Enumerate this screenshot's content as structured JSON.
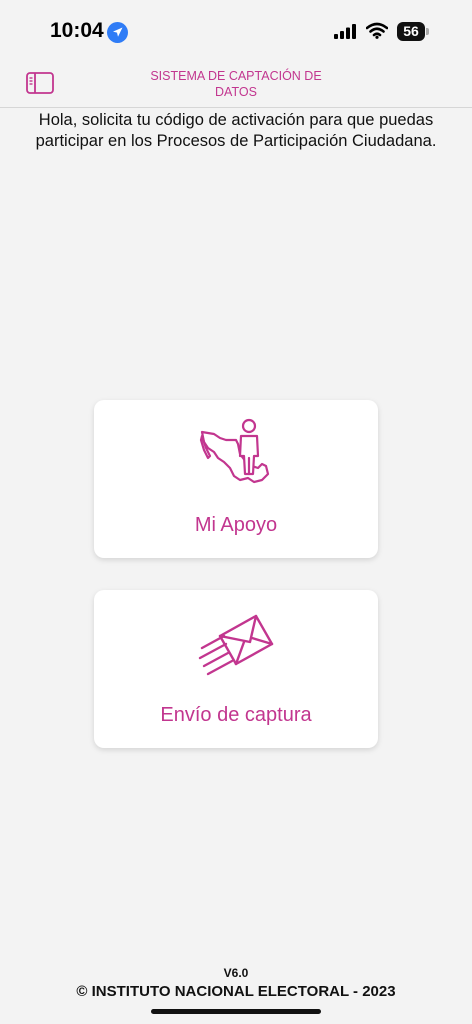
{
  "status_bar": {
    "time": "10:04",
    "battery": "56",
    "icons": [
      "location-arrow-icon",
      "signal-icon",
      "wifi-icon",
      "battery-icon"
    ]
  },
  "header": {
    "title": "SISTEMA DE CAPTACIÓN DE DATOS",
    "menu_icon": "sidebar-toggle-icon"
  },
  "intro_text": "Hola, solicita tu código de activación para que puedas participar en los Procesos de Participación Ciudadana.",
  "cards": [
    {
      "label": "Mi Apoyo",
      "icon": "person-map-icon"
    },
    {
      "label": "Envío de captura",
      "icon": "envelope-send-icon"
    }
  ],
  "footer": {
    "version": "V6.0",
    "copyright": "© INSTITUTO NACIONAL ELECTORAL - 2023"
  },
  "colors": {
    "accent": "#c2368f",
    "background": "#f3f3f3",
    "card": "#ffffff",
    "location": "#2f7cf6"
  }
}
